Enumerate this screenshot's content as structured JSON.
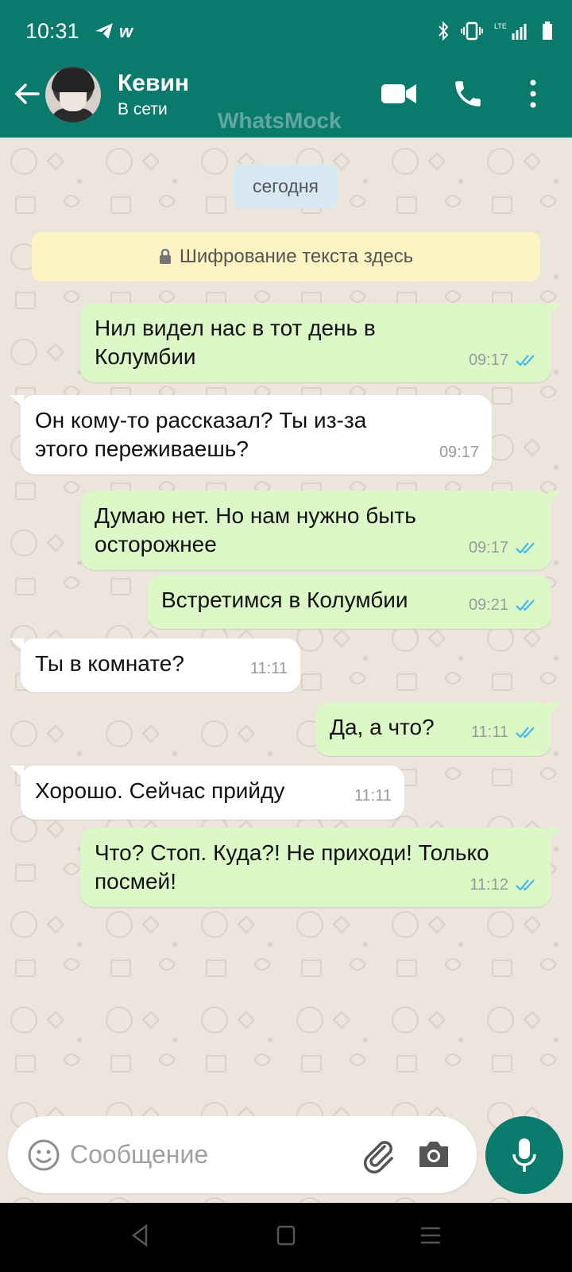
{
  "status_bar": {
    "time": "10:31",
    "app_icons": [
      "telegram-icon",
      "w-app-icon"
    ],
    "w_icon_letter": "w",
    "right_icons": [
      "bluetooth-icon",
      "vibrate-icon",
      "lte-signal-icon",
      "battery-icon"
    ]
  },
  "header": {
    "contact_name": "Кевин",
    "status": "В сети",
    "watermark": "WhatsMock",
    "actions": [
      "video-call-icon",
      "voice-call-icon",
      "more-icon"
    ]
  },
  "chat": {
    "date_label": "сегодня",
    "encryption_notice": "Шифрование текста здесь",
    "messages": [
      {
        "direction": "outgoing",
        "text": "Нил видел нас в тот день в Колумбии",
        "time": "09:17",
        "read": true
      },
      {
        "direction": "incoming",
        "text": "Он кому-то рассказал? Ты из-за этого переживаешь?",
        "time": "09:17"
      },
      {
        "direction": "outgoing",
        "text": "Думаю нет. Но нам нужно быть осторожнее",
        "time": "09:17",
        "read": true
      },
      {
        "direction": "outgoing",
        "text": "Встретимся в Колумбии",
        "time": "09:21",
        "read": true
      },
      {
        "direction": "incoming",
        "text": "Ты в комнате?",
        "time": "11:11"
      },
      {
        "direction": "outgoing",
        "text": "Да, а что?",
        "time": "11:11",
        "read": true
      },
      {
        "direction": "incoming",
        "text": "Хорошо. Сейчас прийду",
        "time": "11:11"
      },
      {
        "direction": "outgoing",
        "text": "Что? Стоп. Куда?! Не приходи! Только посмей!",
        "time": "11:12",
        "read": true
      }
    ]
  },
  "composer": {
    "placeholder": "Сообщение",
    "icons": [
      "emoji-icon",
      "attach-icon",
      "camera-icon",
      "mic-icon"
    ]
  },
  "colors": {
    "header": "#0a7a6c",
    "outgoing_bubble": "#dcf8c6",
    "incoming_bubble": "#ffffff",
    "chat_background": "#ece5dd",
    "read_ticks": "#34b7f1"
  }
}
